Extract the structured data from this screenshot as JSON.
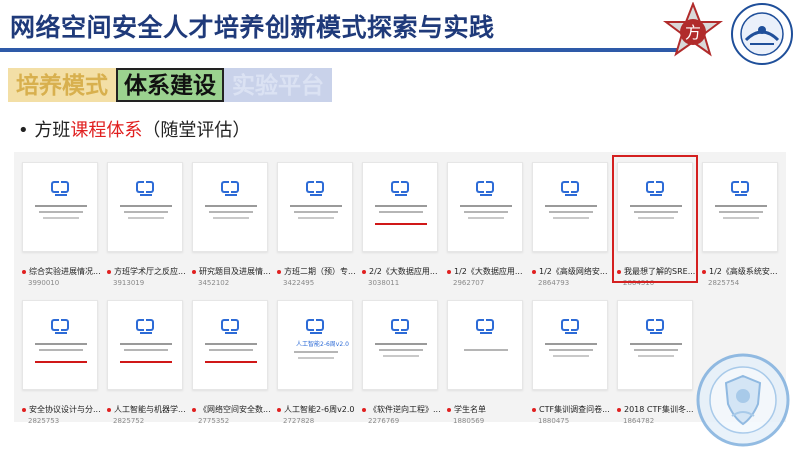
{
  "header": {
    "title": "网络空间安全人才培养创新模式探索与实践",
    "logo2_text": "上海交通大学网络安全技术研究院"
  },
  "tabs": [
    {
      "label": "培养模式"
    },
    {
      "label": "体系建设"
    },
    {
      "label": "实验平台"
    }
  ],
  "bullet": {
    "prefix": "• 方班",
    "highlight": "课程体系",
    "suffix": "（随堂评估）"
  },
  "cards_row1": [
    {
      "caption": "综合实验进展情况...",
      "count": "3990010"
    },
    {
      "caption": "方班学术厅之反应...",
      "count": "3913019"
    },
    {
      "caption": "研究题目及进展情...",
      "count": "3452102"
    },
    {
      "caption": "方班二期（预）专...",
      "count": "3422495"
    },
    {
      "caption": "2/2《大数据应用...",
      "count": "3038011"
    },
    {
      "caption": "1/2《大数据应用...",
      "count": "2962707"
    },
    {
      "caption": "1/2《高级网络安...",
      "count": "2864793"
    },
    {
      "caption": "我最想了解的SRE...",
      "count": "2864510"
    },
    {
      "caption": "1/2《高级系统安...",
      "count": "2825754"
    }
  ],
  "cards_row2": [
    {
      "caption": "安全协议设计与分...",
      "count": "2825753"
    },
    {
      "caption": "人工智能与机器学...",
      "count": "2825752"
    },
    {
      "caption": "《网络空间安全数...",
      "count": "2775352"
    },
    {
      "caption": "人工智能2-6周v2.0",
      "count": "2727828"
    },
    {
      "caption": "《软件逆向工程》...",
      "count": "2276769"
    },
    {
      "caption": "学生名单",
      "count": "1880569"
    },
    {
      "caption": "CTF集训调查问卷...",
      "count": "1880475"
    },
    {
      "caption": "2018 CTF集训冬...",
      "count": "1864782"
    }
  ],
  "thumb_text": {
    "ai_title": "人工智能2-6周v2.0"
  },
  "colors": {
    "title": "#1f3a7a",
    "accent_red": "#e02020",
    "tab_green": "#9bd28f",
    "tab_yellow": "#f3dfa6",
    "tab_blue": "#c9d2ea"
  },
  "icons": [
    "fang-logo-icon",
    "university-seal-icon",
    "cyber-security-seal-icon"
  ]
}
